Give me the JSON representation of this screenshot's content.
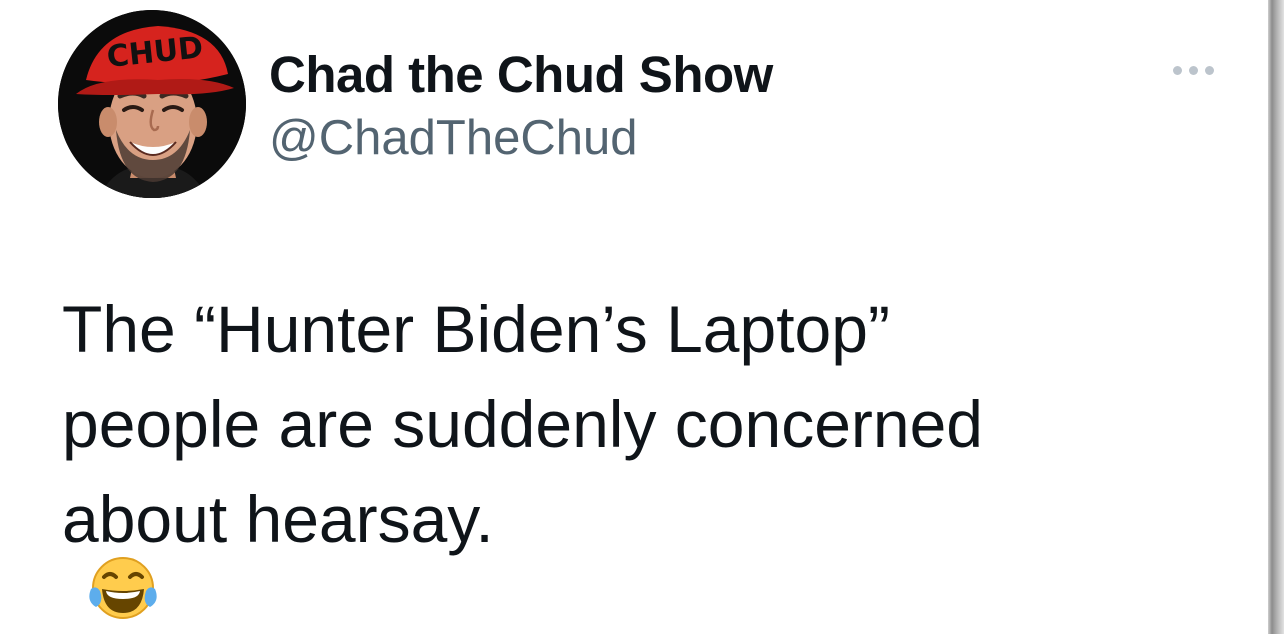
{
  "author": {
    "display_name": "Chad the Chud Show",
    "handle": "@ChadTheChud",
    "avatar": {
      "icon": "avatar-photo-icon",
      "hat_text": "CHUD",
      "hat_color": "#d6231e",
      "background_color": "#0b0b0b"
    }
  },
  "more_menu": {
    "icon": "more-horizontal-icon"
  },
  "tweet": {
    "lines": [
      "The “Hunter Biden’s Laptop”",
      "people are suddenly concerned",
      "about hearsay."
    ],
    "emoji": "face-with-tears-of-joy-icon"
  },
  "colors": {
    "text_primary": "#0f1419",
    "text_secondary": "#536471",
    "background": "#ffffff"
  }
}
